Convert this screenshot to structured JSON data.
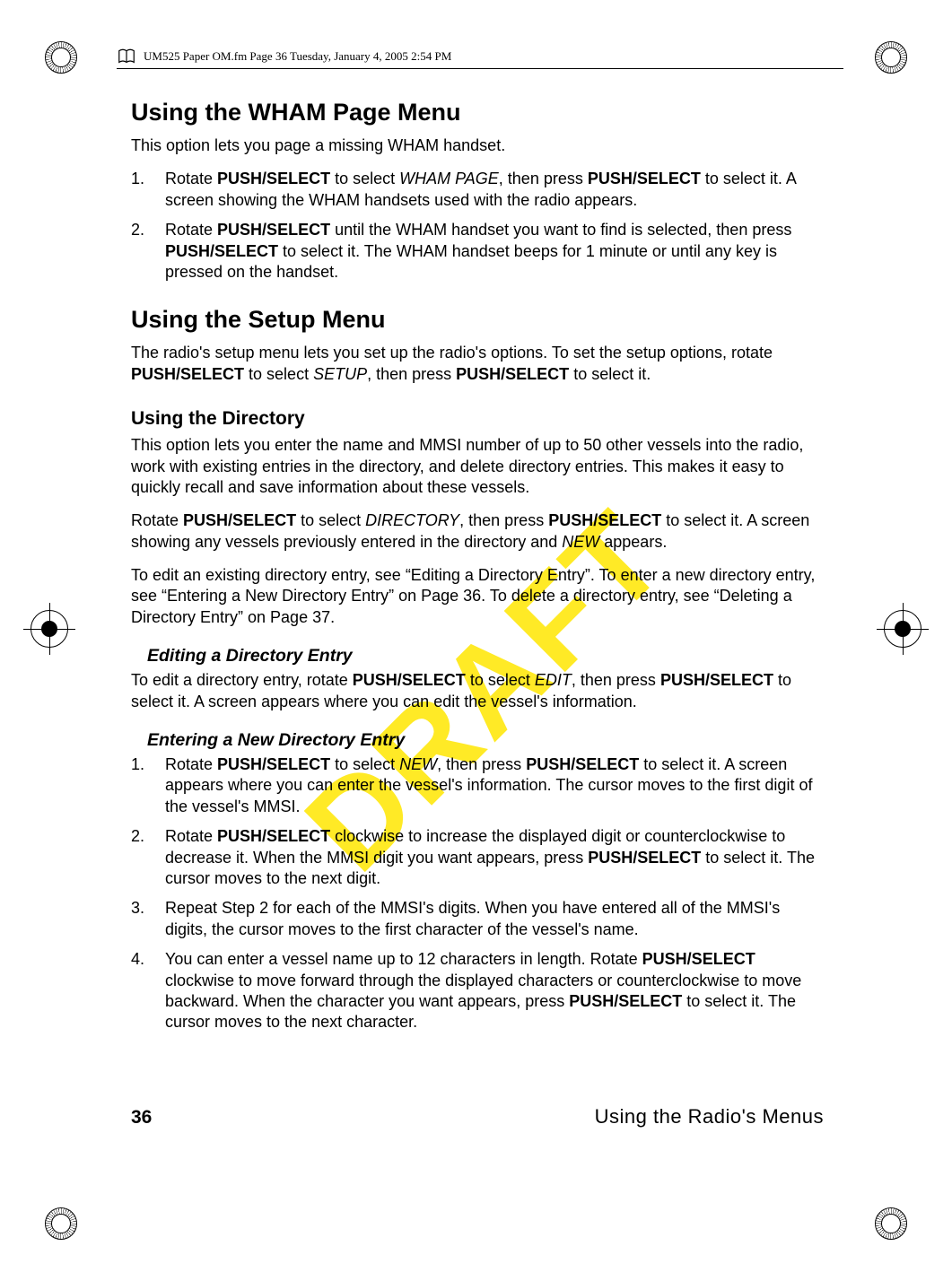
{
  "header": {
    "running_head": "UM525 Paper OM.fm  Page 36  Tuesday, January 4, 2005  2:54 PM"
  },
  "watermark": "DRAFT",
  "sections": {
    "wham": {
      "title": "Using the WHAM Page Menu",
      "intro": "This option lets you page a missing WHAM handset.",
      "steps": [
        "Rotate PUSH/SELECT to select WHAM PAGE, then press PUSH/SELECT to select it. A screen showing the WHAM handsets used with the radio appears.",
        "Rotate PUSH/SELECT until the WHAM handset you want to find is selected, then press PUSH/SELECT to select it. The WHAM handset beeps for 1 minute or until any key is pressed on the handset."
      ]
    },
    "setup": {
      "title": "Using the Setup Menu",
      "intro": "The radio's setup menu lets you set up the radio's options. To set the setup options, rotate PUSH/SELECT to select SETUP, then press PUSH/SELECT to select it.",
      "directory": {
        "title": "Using the Directory",
        "p1": "This option lets you enter the name and MMSI number of up to 50 other vessels into the radio, work with existing entries in the directory, and delete directory entries. This makes it easy to quickly recall and save information about these vessels.",
        "p2": "Rotate PUSH/SELECT to select DIRECTORY, then press PUSH/SELECT to select it. A screen showing any vessels previously entered in the directory and NEW appears.",
        "p3": "To edit an existing directory entry, see “Editing a Directory Entry”. To enter a new directory entry, see “Entering a New Directory Entry” on Page 36. To delete a directory entry, see “Deleting a Directory Entry” on Page 37.",
        "edit": {
          "title": "Editing a Directory Entry",
          "p": "To edit a directory entry, rotate PUSH/SELECT to select EDIT, then press PUSH/SELECT to select it. A screen appears where you can edit the vessel's information."
        },
        "new": {
          "title": "Entering a New Directory Entry",
          "steps": [
            "Rotate PUSH/SELECT to select NEW, then press PUSH/SELECT to select it. A screen appears where you can enter the vessel's information. The cursor moves to the first digit of the vessel's MMSI.",
            "Rotate PUSH/SELECT clockwise to increase the displayed digit or counterclockwise to decrease it. When the MMSI digit you want appears, press PUSH/SELECT to select it. The cursor moves to the next digit.",
            "Repeat Step 2 for each of the MMSI's digits. When you have entered all of the MMSI's digits, the cursor moves to the first character of the vessel's name.",
            "You can enter a vessel name up to 12 characters in length. Rotate PUSH/SELECT clockwise to move forward through the displayed characters or counterclockwise to move backward. When the character you want appears, press PUSH/SELECT to select it. The cursor moves to the next character."
          ]
        }
      }
    }
  },
  "footer": {
    "page": "36",
    "section": "Using the Radio's Menus"
  }
}
